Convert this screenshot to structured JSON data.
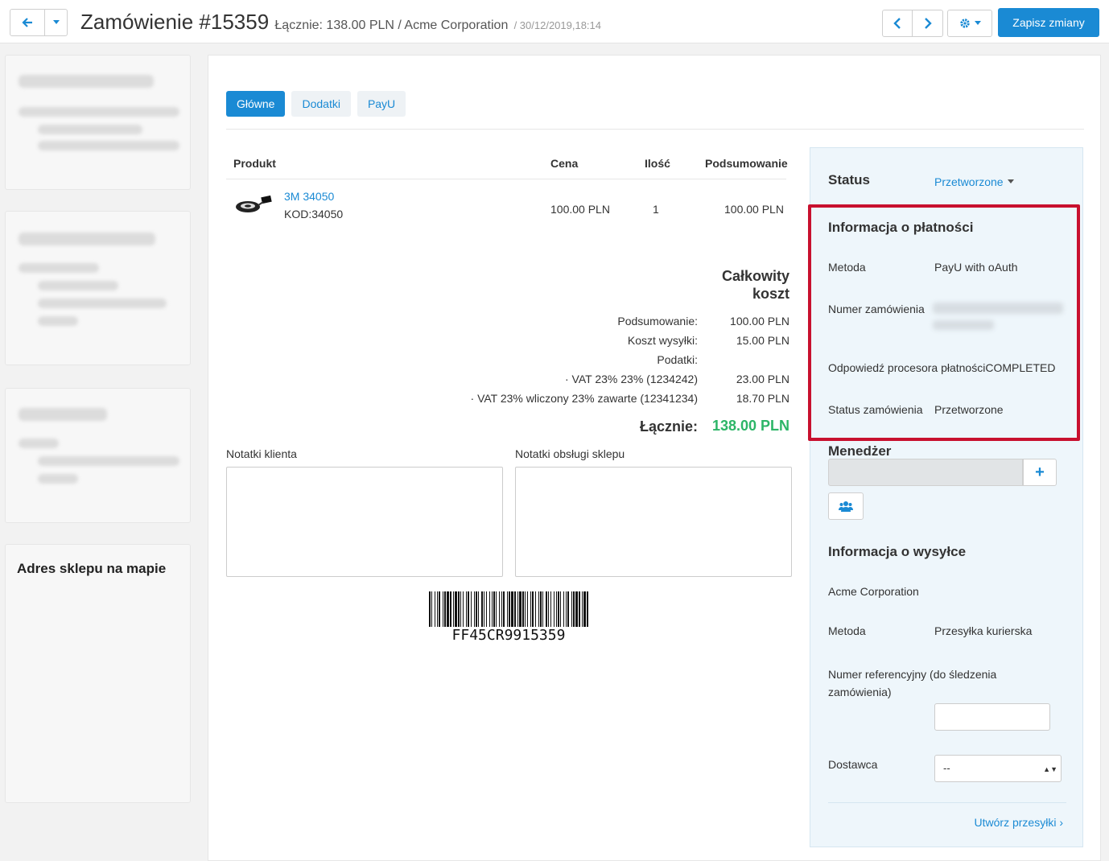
{
  "header": {
    "title": "Zamówienie #15359",
    "subtitle": "Łącznie: 138.00 PLN / Acme Corporation",
    "date": "/ 30/12/2019,18:14",
    "save_label": "Zapisz zmiany"
  },
  "sidebar": {
    "map_title": "Adres sklepu na mapie"
  },
  "tabs": [
    {
      "label": "Główne",
      "active": true
    },
    {
      "label": "Dodatki",
      "active": false
    },
    {
      "label": "PayU",
      "active": false
    }
  ],
  "table": {
    "headers": {
      "product": "Produkt",
      "price": "Cena",
      "qty": "Ilość",
      "total": "Podsumowanie"
    },
    "rows": [
      {
        "name": "3M 34050",
        "code": "KOD:34050",
        "price": "100.00 PLN",
        "qty": "1",
        "total": "100.00 PLN"
      }
    ]
  },
  "totals": {
    "title_line1": "Całkowity",
    "title_line2": "koszt",
    "lines": [
      {
        "label": "Podsumowanie:",
        "value": "100.00 PLN"
      },
      {
        "label": "Koszt wysyłki:",
        "value": "15.00 PLN"
      },
      {
        "label": "Podatki:",
        "value": ""
      },
      {
        "label": "· VAT 23% 23% (1234242)",
        "value": "23.00 PLN"
      },
      {
        "label": "· VAT 23% wliczony 23% zawarte (12341234)",
        "value": "18.70 PLN"
      }
    ],
    "grand_label": "Łącznie:",
    "grand_value": "138.00 PLN"
  },
  "notes": {
    "customer_label": "Notatki klienta",
    "staff_label": "Notatki obsługi sklepu"
  },
  "barcode": {
    "text": "FF45CR9915359"
  },
  "right_panel": {
    "status_heading": "Status",
    "status_value": "Przetworzone",
    "payment_heading": "Informacja o płatności",
    "method_label": "Metoda",
    "method_value": "PayU with oAuth",
    "order_number_label": "Numer zamówienia",
    "processor_label": "Odpowiedź procesora płatności",
    "processor_value": "COMPLETED",
    "order_status_label": "Status zamówienia",
    "order_status_value": "Przetworzone",
    "manager_heading": "Menedżer",
    "shipping_heading": "Informacja o wysyłce",
    "company": "Acme Corporation",
    "shipping_method_label": "Metoda",
    "shipping_method_value": "Przesyłka kurierska",
    "tracking_label_line1": "Numer referencyjny (do śledzenia",
    "tracking_label_line2": "zamówienia)",
    "supplier_label": "Dostawca",
    "supplier_value": "--",
    "create_shipment": "Utwórz przesyłki ›"
  },
  "colors": {
    "accent": "#1a8ad4",
    "success": "#2cb567",
    "highlight": "#c8102e"
  }
}
